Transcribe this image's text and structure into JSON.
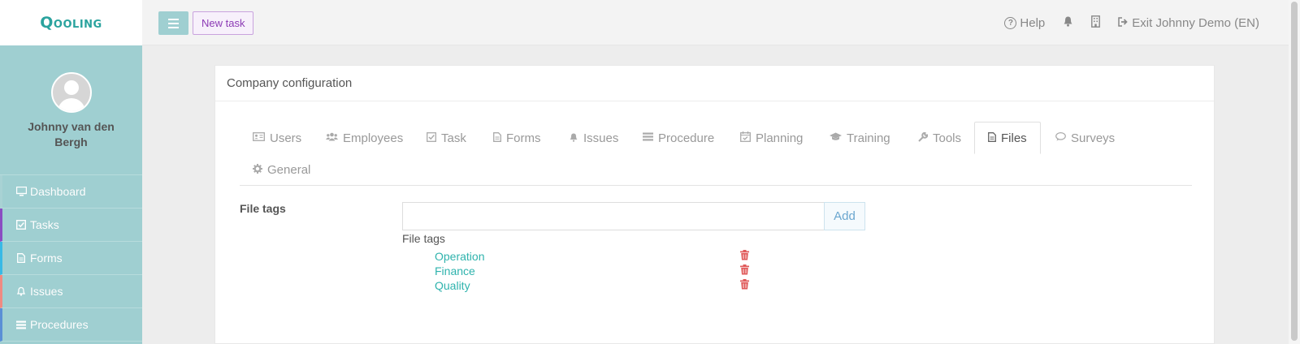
{
  "app": {
    "logo": "Qooling"
  },
  "user": {
    "name": "Johnny van den Bergh"
  },
  "sidebar": {
    "items": [
      {
        "label": "Dashboard",
        "icon": "monitor-icon"
      },
      {
        "label": "Tasks",
        "icon": "check-square-icon"
      },
      {
        "label": "Forms",
        "icon": "file-icon"
      },
      {
        "label": "Issues",
        "icon": "bell-icon"
      },
      {
        "label": "Procedures",
        "icon": "list-icon"
      }
    ]
  },
  "topbar": {
    "new_task_label": "New task",
    "help_label": "Help",
    "exit_label": "Exit Johnny Demo (EN)"
  },
  "panel": {
    "title": "Company configuration",
    "tabs": [
      {
        "label": "Users",
        "icon": "id-card-icon"
      },
      {
        "label": "Employees",
        "icon": "users-icon"
      },
      {
        "label": "Task",
        "icon": "check-square-icon"
      },
      {
        "label": "Forms",
        "icon": "file-icon"
      },
      {
        "label": "Issues",
        "icon": "bell-icon"
      },
      {
        "label": "Procedure",
        "icon": "list-icon"
      },
      {
        "label": "Planning",
        "icon": "calendar-icon"
      },
      {
        "label": "Training",
        "icon": "graduation-cap-icon"
      },
      {
        "label": "Tools",
        "icon": "wrench-icon"
      },
      {
        "label": "Files",
        "icon": "file-icon",
        "active": true
      },
      {
        "label": "Surveys",
        "icon": "comment-icon"
      },
      {
        "label": "General",
        "icon": "gear-icon"
      }
    ]
  },
  "file_tags": {
    "label": "File tags",
    "input_value": "",
    "add_label": "Add",
    "list_title": "File tags",
    "tags": [
      "Operation",
      "Finance",
      "Quality"
    ]
  },
  "colors": {
    "brand": "#2aa39e",
    "sidebar": "#9fcfd1",
    "tag_link": "#2fb3ad",
    "delete": "#e05a5a"
  }
}
